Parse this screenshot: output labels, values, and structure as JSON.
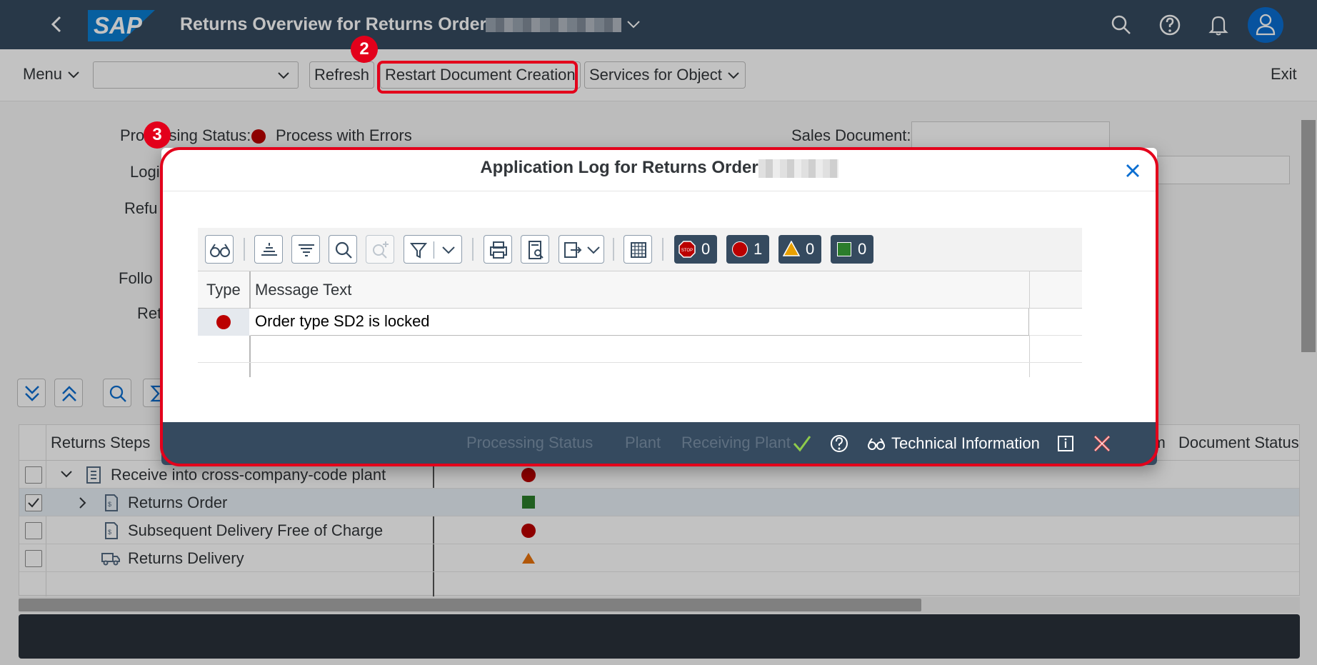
{
  "shell": {
    "logo_text": "SAP",
    "title": "Returns Overview for Returns Order"
  },
  "toolbar": {
    "menu_label": "Menu",
    "refresh_label": "Refresh",
    "restart_label": "Restart Document Creation",
    "services_label": "Services for Object",
    "exit_label": "Exit"
  },
  "annotations": {
    "step2": "2",
    "step3": "3"
  },
  "form": {
    "processing_status_label": "Processing Status:",
    "processing_status_value": "Process with Errors",
    "sales_document_label": "Sales Document:",
    "logistics_label": "Logi",
    "refund_label": "Refu",
    "follow_label": "Follo",
    "ret_label": "Ret"
  },
  "steps": {
    "headers": {
      "returns_steps": "Returns Steps",
      "processing_status": "Processing Status",
      "plant": "Plant",
      "receiving_plant": "Receiving Plant",
      "item": "Item",
      "document_status": "Document Status"
    },
    "rows": [
      {
        "label": "Receive into cross-company-code plant",
        "status": "error",
        "checked": false
      },
      {
        "label": "Returns Order",
        "status": "success",
        "checked": true
      },
      {
        "label": "Subsequent Delivery Free of Charge",
        "status": "error",
        "checked": false
      },
      {
        "label": "Returns Delivery",
        "status": "warning",
        "checked": false
      }
    ]
  },
  "dialog": {
    "title": "Application Log for Returns Order",
    "counts": {
      "stop": "0",
      "error": "1",
      "warning": "0",
      "success": "0"
    },
    "columns": {
      "type": "Type",
      "message_text": "Message Text"
    },
    "messages": [
      {
        "type": "error",
        "text": "Order type SD2 is locked"
      }
    ],
    "footer": {
      "technical_information": "Technical Information"
    }
  },
  "colors": {
    "shell": "#354a5f",
    "highlight": "#e3001b",
    "error": "#bb0000",
    "success": "#2b7d2b",
    "warning": "#e9730c"
  }
}
